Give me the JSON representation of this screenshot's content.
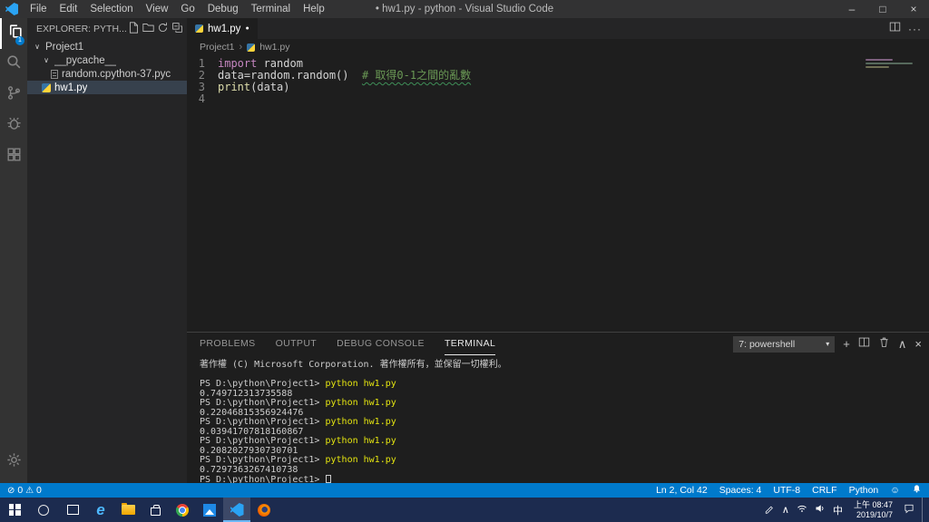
{
  "glyphs": {
    "chevron_expanded": "∨",
    "breadcrumb_sep": "›",
    "modified_dot": "●",
    "minimize": "–",
    "maximize": "□",
    "close": "×",
    "dropdown_arrow": "▾",
    "chevron_up": "∧",
    "plus": "+",
    "more": "···",
    "error": "⊘",
    "warning": "⚠",
    "smiley": "☺"
  },
  "title_bar": {
    "menus": [
      "File",
      "Edit",
      "Selection",
      "View",
      "Go",
      "Debug",
      "Terminal",
      "Help"
    ],
    "title": "• hw1.py - python - Visual Studio Code"
  },
  "activity_bar": {
    "badge": "1"
  },
  "sidebar": {
    "header": "EXPLORER: PYTH...",
    "tree": [
      {
        "label": "Project1",
        "level": 0,
        "type": "folder",
        "expanded": true
      },
      {
        "label": "__pycache__",
        "level": 1,
        "type": "folder",
        "expanded": true
      },
      {
        "label": "random.cpython-37.pyc",
        "level": 2,
        "type": "file",
        "icon": "file"
      },
      {
        "label": "hw1.py",
        "level": 1,
        "type": "file",
        "icon": "python",
        "selected": true
      }
    ]
  },
  "editor": {
    "tab": {
      "label": "hw1.py",
      "modified": true
    },
    "breadcrumb": [
      "Project1",
      "hw1.py"
    ],
    "code": [
      {
        "num": "1",
        "tokens": [
          {
            "t": "import",
            "c": "keyword"
          },
          {
            "t": " random",
            "c": "plain"
          }
        ]
      },
      {
        "num": "2",
        "tokens": [
          {
            "t": "data=random.random()",
            "c": "plain"
          },
          {
            "t": "  ",
            "c": "plain"
          },
          {
            "t": "# 取得0-1之間的亂數",
            "c": "comment",
            "u": true
          }
        ]
      },
      {
        "num": "3",
        "tokens": [
          {
            "t": "print",
            "c": "func"
          },
          {
            "t": "(data)",
            "c": "plain"
          }
        ]
      },
      {
        "num": "4",
        "tokens": []
      }
    ]
  },
  "panel": {
    "tabs": [
      "PROBLEMS",
      "OUTPUT",
      "DEBUG CONSOLE",
      "TERMINAL"
    ],
    "active_tab": "TERMINAL",
    "shell_select": "7: powershell",
    "terminal_lines": [
      {
        "text": "著作權 (C) Microsoft Corporation. 著作權所有，並保留一切權利。"
      },
      {
        "blank": true
      },
      {
        "prompt": "PS D:\\python\\Project1>",
        "command": "python hw1.py"
      },
      {
        "text": "0.749712313735588"
      },
      {
        "prompt": "PS D:\\python\\Project1>",
        "command": "python hw1.py"
      },
      {
        "text": "0.22046815356924476"
      },
      {
        "prompt": "PS D:\\python\\Project1>",
        "command": "python hw1.py"
      },
      {
        "text": "0.03941707818160867"
      },
      {
        "prompt": "PS D:\\python\\Project1>",
        "command": "python hw1.py"
      },
      {
        "text": "0.2082027930730701"
      },
      {
        "prompt": "PS D:\\python\\Project1>",
        "command": "python hw1.py"
      },
      {
        "text": "0.7297363267410738"
      },
      {
        "prompt": "PS D:\\python\\Project1>",
        "cursor": true
      }
    ]
  },
  "status_bar": {
    "errors": "0",
    "warnings": "0",
    "items": [
      {
        "id": "cursor-position",
        "label": "Ln 2, Col 42"
      },
      {
        "id": "indentation",
        "label": "Spaces: 4"
      },
      {
        "id": "encoding",
        "label": "UTF-8"
      },
      {
        "id": "eol",
        "label": "CRLF"
      },
      {
        "id": "language-mode",
        "label": "Python"
      }
    ]
  },
  "taskbar": {
    "apps": [
      {
        "id": "edge"
      },
      {
        "id": "file-explorer"
      },
      {
        "id": "store"
      },
      {
        "id": "chrome"
      },
      {
        "id": "photos"
      },
      {
        "id": "vscode",
        "active": true
      },
      {
        "id": "firefox"
      }
    ],
    "ime": "中",
    "time": "上午 08:47",
    "date": "2019/10/7"
  }
}
